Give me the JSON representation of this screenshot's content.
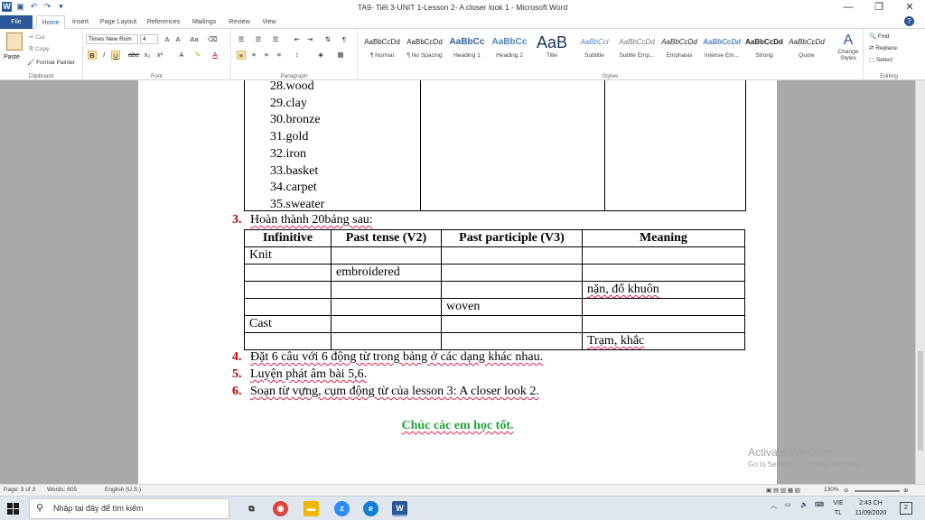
{
  "titlebar": {
    "title": "TA9- Tiết 3-UNIT 1-Lesson 2- A closer look 1  -  Microsoft Word",
    "minimize": "—",
    "restore": "❐",
    "close": "✕"
  },
  "tabs": [
    "File",
    "Home",
    "Insert",
    "Page Layout",
    "References",
    "Mailings",
    "Review",
    "View"
  ],
  "ribbon": {
    "clipboard": {
      "paste": "Paste",
      "cut": "Cut",
      "copy": "Copy",
      "format_painter": "Format Painter",
      "label": "Clipboard"
    },
    "font": {
      "name": "Times New Rom",
      "size": "4",
      "label": "Font"
    },
    "paragraph": {
      "label": "Paragraph"
    },
    "styles": {
      "label": "Styles",
      "items": [
        {
          "sample": "AaBbCcDd",
          "name": "¶ Normal"
        },
        {
          "sample": "AaBbCcDd",
          "name": "¶ No Spacing"
        },
        {
          "sample": "AaBbCc",
          "name": "Heading 1"
        },
        {
          "sample": "AaBbCc",
          "name": "Heading 2"
        },
        {
          "sample": "AaB",
          "name": "Title"
        },
        {
          "sample": "AaBbCcl",
          "name": "Subtitle"
        },
        {
          "sample": "AaBbCcDd",
          "name": "Subtle Emp..."
        },
        {
          "sample": "AaBbCcDd",
          "name": "Emphasis"
        },
        {
          "sample": "AaBbCcDd",
          "name": "Intense Em..."
        },
        {
          "sample": "AaBbCcDd",
          "name": "Strong"
        },
        {
          "sample": "AaBbCcDd",
          "name": "Quote"
        }
      ],
      "change_styles": "Change Styles"
    },
    "editing": {
      "find": "Find",
      "replace": "Replace",
      "select": "Select",
      "label": "Editing"
    }
  },
  "document": {
    "word_list": [
      "28.wood",
      "29.clay",
      "30.bronze",
      "31.gold",
      "32.iron",
      "33.basket",
      "34.carpet",
      "35.sweater"
    ],
    "task3": {
      "num": "3.",
      "text": "Hoàn thành 20bảng sau:"
    },
    "table": {
      "headers": [
        "Infinitive",
        "Past tense (V2)",
        "Past participle  (V3)",
        "Meaning"
      ],
      "rows": [
        [
          "Knit",
          "",
          "",
          ""
        ],
        [
          "",
          "embroidered",
          "",
          ""
        ],
        [
          "",
          "",
          "",
          "nặn, đổ khuôn"
        ],
        [
          "",
          "",
          "woven",
          ""
        ],
        [
          "Cast",
          "",
          "",
          ""
        ],
        [
          "",
          "",
          "",
          "Trạm, khắc"
        ]
      ]
    },
    "tasks": [
      {
        "num": "4.",
        "text": "Đặt 6 câu với 6 động từ trong bảng ở các dạng khác nhau."
      },
      {
        "num": "5.",
        "text": "Luyện phát âm bài 5,6."
      },
      {
        "num": "6.",
        "text": "Soạn từ vựng, cụm động từ của lesson 3: A closer look 2."
      }
    ],
    "closing": "Chúc các em học tốt."
  },
  "watermark": {
    "line1": "Activate Windows",
    "line2": "Go to Settings to activate Windows."
  },
  "statusbar": {
    "page": "Page: 3 of 3",
    "words": "Words: 605",
    "language": "English (U.S.)",
    "zoom": "130%"
  },
  "taskbar": {
    "search_placeholder": "Nhập tại đây để tìm kiếm",
    "language": "VIE",
    "language_sub": "TL",
    "time": "2:43 CH",
    "date": "11/09/2020",
    "notifications": "2"
  }
}
